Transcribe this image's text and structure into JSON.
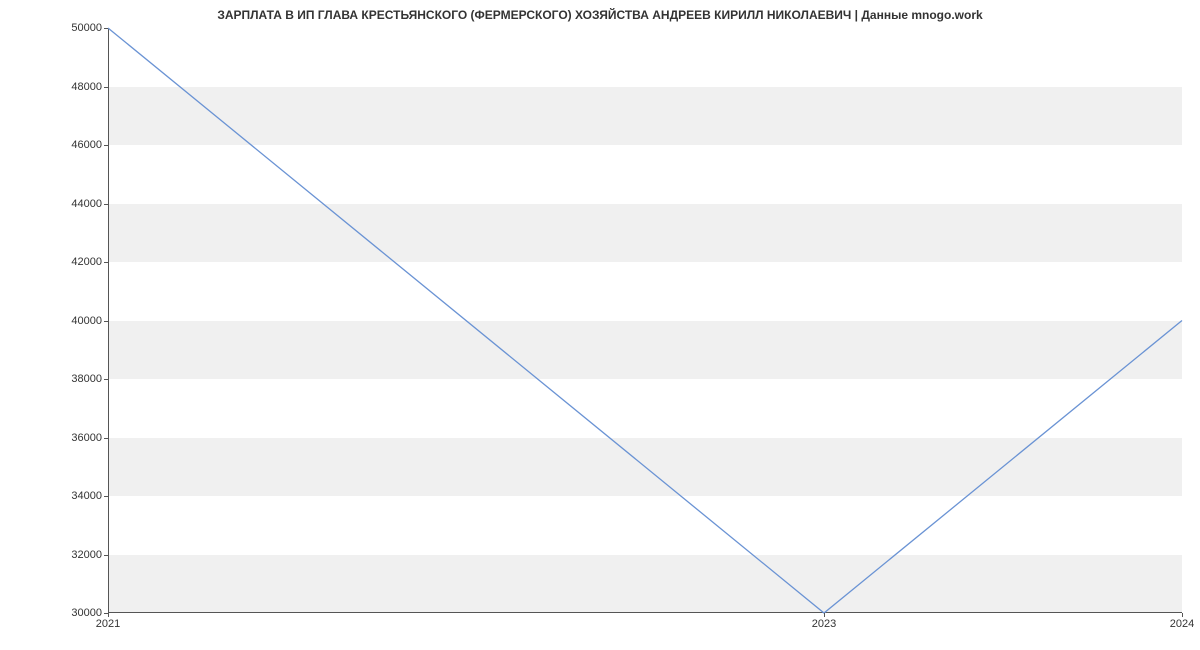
{
  "chart_data": {
    "type": "line",
    "title": "ЗАРПЛАТА В ИП ГЛАВА КРЕСТЬЯНСКОГО (ФЕРМЕРСКОГО) ХОЗЯЙСТВА АНДРЕЕВ КИРИЛЛ НИКОЛАЕВИЧ | Данные mnogo.work",
    "x": [
      2021,
      2023,
      2024
    ],
    "values": [
      50000,
      30000,
      40000
    ],
    "xlabel": "",
    "ylabel": "",
    "xlim": [
      2021,
      2024
    ],
    "ylim": [
      30000,
      50000
    ],
    "y_ticks": [
      30000,
      32000,
      34000,
      36000,
      38000,
      40000,
      42000,
      44000,
      46000,
      48000,
      50000
    ],
    "x_ticks": [
      2021,
      2023,
      2024
    ],
    "line_color": "#6a93d4",
    "band_color": "#f0f0f0"
  }
}
